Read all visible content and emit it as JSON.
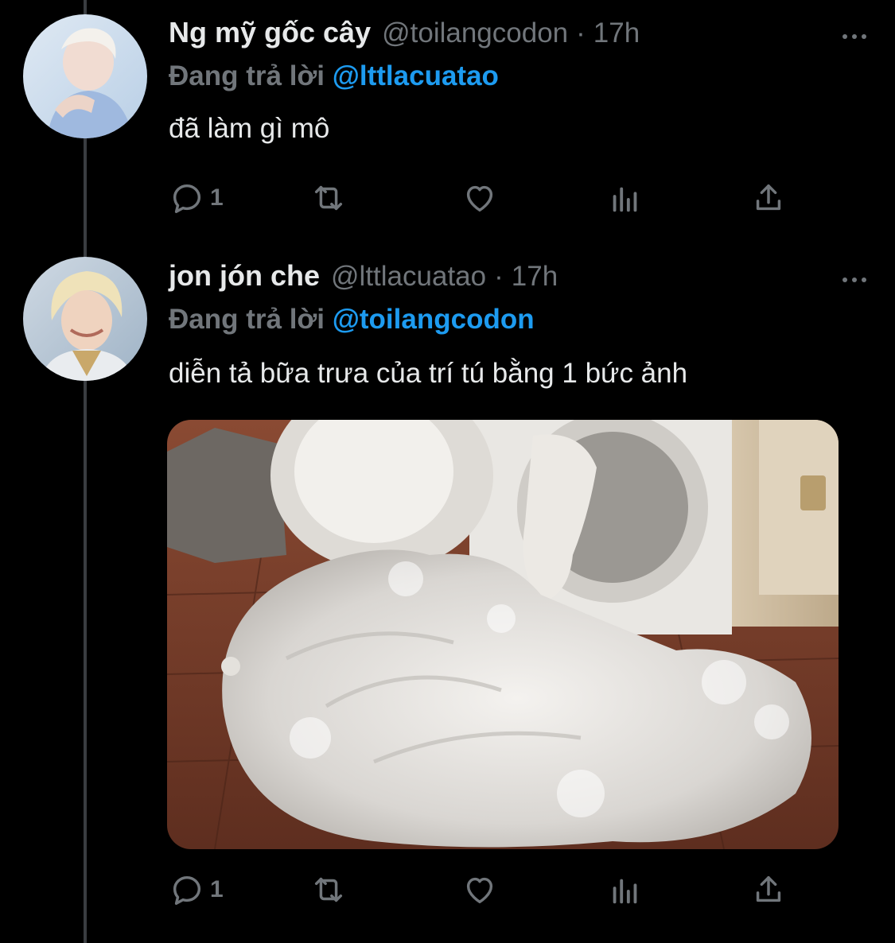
{
  "tweets": [
    {
      "name": "Ng mỹ gốc cây",
      "handle": "@toilangcodon",
      "dot": "·",
      "time": "17h",
      "replying_prefix": "Đang trả lời",
      "replying_to": "@lttlacuatao",
      "text": "đã làm gì mô",
      "reply_count": "1"
    },
    {
      "name": "jon jón che",
      "handle": "@lttlacuatao",
      "dot": "·",
      "time": "17h",
      "replying_prefix": "Đang trả lời",
      "replying_to": "@toilangcodon",
      "text": "diễn tả bữa trưa của trí tú bằng 1 bức ảnh",
      "reply_count": "1"
    }
  ],
  "icons": {
    "reply": "reply-icon",
    "retweet": "retweet-icon",
    "like": "heart-icon",
    "views": "views-icon",
    "share": "share-icon",
    "more": "more-icon"
  },
  "colors": {
    "background": "#000000",
    "text": "#e7e9ea",
    "muted": "#71767b",
    "link": "#1d9bf0"
  }
}
